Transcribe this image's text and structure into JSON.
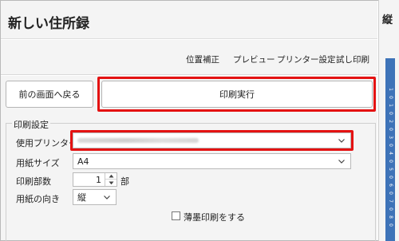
{
  "window": {
    "title": "新しい住所録"
  },
  "toolbar": {
    "items": [
      "位置補正",
      "プレビュー",
      "プリンター設定",
      "試し印刷"
    ]
  },
  "actions": {
    "back_label": "前の画面へ戻る",
    "print_label": "印刷実行"
  },
  "print_settings": {
    "section_title": "印刷設定",
    "printer_label": "使用プリンター",
    "printer_value": "",
    "paper_size_label": "用紙サイズ",
    "paper_size_value": "A4",
    "copies_label": "印刷部数",
    "copies_value": "1",
    "copies_unit": "部",
    "orientation_label": "用紙の向き",
    "orientation_value": "縦",
    "light_ink_label": "薄墨印刷をする",
    "light_ink_checked": false
  },
  "side_panel": {
    "header": "縦",
    "ruler_ticks": [
      "1",
      "0",
      "1",
      "0",
      "2",
      "0",
      "3",
      "0",
      "4",
      "0",
      "5",
      "0",
      "6",
      "0",
      "7",
      "0",
      "8",
      "0"
    ]
  },
  "colors": {
    "highlight": "#e41212",
    "ruler": "#3e73b8",
    "panel_bg": "#f4f4f4"
  },
  "icons": {
    "dropdown": "chevron-down-icon",
    "spin_up": "caret-up-icon",
    "spin_down": "caret-down-icon"
  }
}
